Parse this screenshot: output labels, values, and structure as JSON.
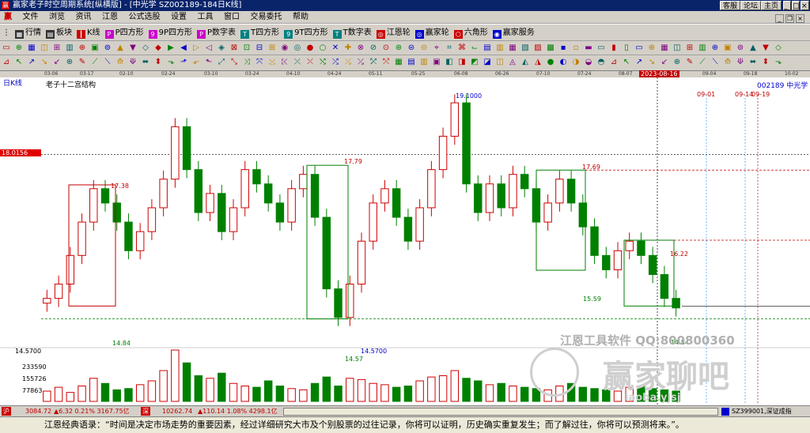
{
  "window": {
    "title": "赢家老子时空周期系统[纵横版] - [中光学  SZ002189-184日K线]",
    "right_buttons": [
      "客服",
      "论坛",
      "主页"
    ]
  },
  "menu": {
    "logo": "赢",
    "items": [
      "文件",
      "浏览",
      "资讯",
      "江恩",
      "公式选股",
      "设置",
      "工具",
      "窗口",
      "交易委托",
      "帮助"
    ]
  },
  "toolbar": {
    "items": [
      {
        "label": "行情",
        "icon": "grid-icon",
        "color": "#333333"
      },
      {
        "label": "板块",
        "icon": "blocks-icon",
        "color": "#333333"
      },
      {
        "label": "K线",
        "icon": "candle-icon",
        "color": "#cc0000"
      },
      {
        "label": "P四方形",
        "icon": "square-p-icon",
        "color": "#cc00cc"
      },
      {
        "label": "9P四方形",
        "icon": "square-9p-icon",
        "color": "#cc00cc"
      },
      {
        "label": "P数字表",
        "icon": "table-p-icon",
        "color": "#cc00cc"
      },
      {
        "label": "T四方形",
        "icon": "square-t-icon",
        "color": "#008080"
      },
      {
        "label": "9T四方形",
        "icon": "square-9t-icon",
        "color": "#008080"
      },
      {
        "label": "T数字表",
        "icon": "table-t-icon",
        "color": "#008080"
      },
      {
        "label": "江恩轮",
        "icon": "wheel-icon",
        "color": "#cc0000"
      },
      {
        "label": "赢家轮",
        "icon": "wheel-icon",
        "color": "#0000cc"
      },
      {
        "label": "六角形",
        "icon": "hexagon-icon",
        "color": "#cc0000"
      },
      {
        "label": "赢家服务",
        "icon": "service-icon",
        "color": "#0000cc"
      }
    ]
  },
  "date_axis": [
    "03-06",
    "03-17",
    "02-10",
    "02-24",
    "03-10",
    "03-24",
    "04-10",
    "04-24",
    "05-11",
    "05-25",
    "06-08",
    "06-26",
    "07-10",
    "07-24",
    "08-07",
    "2023-08-16",
    "09-04",
    "09-18",
    "10-02"
  ],
  "chart": {
    "period_label": "日K线",
    "indicator_name": "老子十二宫结构",
    "stock_label": "002189 中光学",
    "price_marker": "18.0156",
    "left_price": "14.5700",
    "volume_labels": [
      "233590",
      "155726",
      "77863"
    ],
    "annotations": {
      "high_main": "19.1000",
      "low_main": "14.5700",
      "box1_high": "17.38",
      "box1_low": "14.84",
      "box2_high": "17.79",
      "box2_low": "14.57",
      "box3_high": "17.69",
      "box3_low": "15.59",
      "box4_high": "16.22",
      "box4_low": "14.84",
      "future_dates": [
        "09-01",
        "09-14",
        "09-19"
      ]
    },
    "watermark_text": "江恩工具软件 QQ:800800360",
    "watermark_logo": "赢家聊吧",
    "watermark_sub": "iaoba.yjsj"
  },
  "chart_data": {
    "type": "candlestick",
    "ylabel": "",
    "xlabel": "",
    "ylim": [
      14.0,
      19.5
    ],
    "up_color": "#d00000",
    "down_color": "#008000",
    "segments": [
      [
        14.9,
        15.0
      ],
      [
        15.0,
        15.3
      ],
      [
        15.3,
        15.9
      ],
      [
        15.9,
        16.6
      ],
      [
        16.6,
        17.3
      ],
      [
        17.3,
        17.0
      ],
      [
        17.0,
        16.6
      ],
      [
        16.6,
        16.0
      ],
      [
        16.0,
        16.4
      ],
      [
        16.4,
        16.9
      ],
      [
        16.9,
        17.5
      ],
      [
        17.5,
        18.6
      ],
      [
        18.6,
        17.7
      ],
      [
        17.7,
        16.8
      ],
      [
        16.8,
        17.2
      ],
      [
        17.2,
        16.4
      ],
      [
        16.4,
        16.9
      ],
      [
        16.9,
        17.7
      ],
      [
        17.7,
        17.4
      ],
      [
        17.4,
        17.0
      ],
      [
        17.0,
        16.6
      ],
      [
        16.6,
        17.3
      ],
      [
        17.3,
        17.6
      ],
      [
        17.6,
        16.7
      ],
      [
        16.7,
        15.2
      ],
      [
        15.2,
        14.6
      ],
      [
        14.6,
        15.3
      ],
      [
        15.3,
        16.2
      ],
      [
        16.2,
        17.0
      ],
      [
        17.0,
        17.3
      ],
      [
        17.3,
        16.7
      ],
      [
        16.7,
        16.2
      ],
      [
        16.2,
        16.9
      ],
      [
        16.9,
        17.7
      ],
      [
        17.7,
        18.4
      ],
      [
        18.4,
        19.1
      ],
      [
        19.1,
        17.4
      ],
      [
        17.4,
        16.8
      ],
      [
        16.8,
        17.4
      ],
      [
        17.4,
        16.9
      ],
      [
        16.9,
        17.6
      ],
      [
        17.6,
        17.3
      ],
      [
        17.3,
        16.6
      ],
      [
        16.6,
        17.0
      ],
      [
        17.0,
        17.5
      ],
      [
        17.5,
        17.0
      ],
      [
        17.0,
        16.5
      ],
      [
        16.5,
        15.9
      ],
      [
        15.9,
        15.6
      ],
      [
        15.6,
        16.0
      ],
      [
        16.0,
        16.2
      ],
      [
        16.2,
        15.9
      ],
      [
        15.9,
        15.5
      ],
      [
        15.5,
        15.0
      ],
      [
        15.0,
        14.8
      ]
    ],
    "volume": [
      40,
      55,
      35,
      60,
      90,
      70,
      45,
      50,
      65,
      80,
      120,
      200,
      150,
      100,
      90,
      110,
      70,
      60,
      55,
      80,
      60,
      50,
      45,
      70,
      95,
      60,
      90,
      85,
      70,
      65,
      55,
      60,
      80,
      95,
      100,
      120,
      90,
      80,
      65,
      70,
      60,
      55,
      50,
      45,
      60,
      70,
      55,
      50,
      45,
      40,
      55,
      60,
      50,
      45,
      40
    ]
  },
  "status_bar": {
    "index1": "3084.72",
    "index1_change": "▲6.32 0.21% 3167.75亿",
    "index2": "10262.74",
    "index2_change": "▲110.14 1.08% 4298.1亿",
    "index_name": "SZ399001,深证成指"
  },
  "quote": "江恩经典语录：“时间是决定市场走势的重要因素，经过详细研究大市及个别股票的过往记录，你将可以证明，历史确实重复发生；而了解过往，你将可以预测将来。”。"
}
